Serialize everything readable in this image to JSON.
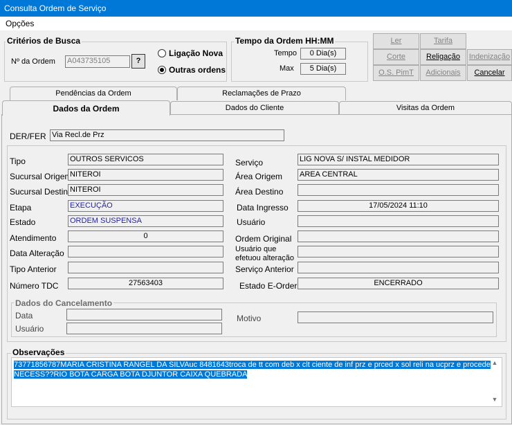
{
  "window": {
    "title": "Consulta Ordem de Serviço"
  },
  "menu": {
    "opcoes": "Opções"
  },
  "criterios": {
    "title": "Critérios de Busca",
    "ordem_label": "Nº da Ordem",
    "ordem_value": "A043735105",
    "lookup_button": "?",
    "radio_ligacao": "Ligação Nova",
    "radio_outras": "Outras ordens",
    "selected": "Outras ordens"
  },
  "tempo": {
    "title": "Tempo da Ordem HH:MM",
    "tempo_label": "Tempo",
    "tempo_value": "0 Dia(s)",
    "max_label": "Max",
    "max_value": "5 Dia(s)"
  },
  "buttons": {
    "ler": "Ler",
    "tarifa": "Tarifa",
    "corte": "Corte",
    "religacao": "Religação",
    "indenizacao": "Indenização",
    "os_pimt": "O.S. PimT",
    "adicionais": "Adicionais",
    "cancelar": "Cancelar"
  },
  "tabs": {
    "row1": [
      "Pendências da Ordem",
      "Reclamações de Prazo"
    ],
    "row2": [
      "Dados da Ordem",
      "Dados do Cliente",
      "Visitas da Ordem"
    ],
    "active": "Dados da Ordem"
  },
  "der_fer": {
    "label": "DER/FER",
    "value": "Via Recl.de Prz"
  },
  "dados": {
    "tipo_label": "Tipo",
    "tipo_value": "OUTROS SERVICOS",
    "servico_label": "Serviço",
    "servico_value": "LIG NOVA S/ INSTAL MEDIDOR",
    "sucursal_origem_label": "Sucursal Origem",
    "sucursal_origem_value": "NITEROI",
    "area_origem_label": "Área Origem",
    "area_origem_value": "AREA CENTRAL",
    "sucursal_destino_label": "Sucursal Destino",
    "sucursal_destino_value": "NITEROI",
    "area_destino_label": "Área Destino",
    "area_destino_value": "",
    "etapa_label": "Etapa",
    "etapa_value": "EXECUÇÃO",
    "data_ingresso_label": "Data Ingresso",
    "data_ingresso_value": "17/05/2024 11:10",
    "estado_label": "Estado",
    "estado_value": "ORDEM SUSPENSA",
    "usuario_label": "Usuário",
    "usuario_value": "",
    "atendimento_label": "Atendimento",
    "atendimento_value": "0",
    "ordem_original_label": "Ordem Original",
    "ordem_original_value": "",
    "data_alteracao_label": "Data Alteração",
    "data_alteracao_value": "",
    "usuario_alteracao_label_1": "Usuário que",
    "usuario_alteracao_label_2": "efetuou alteração",
    "usuario_alteracao_value": "",
    "tipo_anterior_label": "Tipo Anterior",
    "tipo_anterior_value": "",
    "servico_anterior_label": "Serviço Anterior",
    "servico_anterior_value": "",
    "numero_tdc_label": "Número TDC",
    "numero_tdc_value": "27563403",
    "estado_eorder_label": "Estado E-Order",
    "estado_eorder_value": "ENCERRADO"
  },
  "cancelamento": {
    "title": "Dados do Cancelamento",
    "data_label": "Data",
    "data_value": "",
    "usuario_label": "Usuário",
    "usuario_value": "",
    "motivo_label": "Motivo",
    "motivo_value": ""
  },
  "observacoes": {
    "title": "Observações",
    "line1": "73771856787MARIA CRISTINA RANGEL DA SILVAuc 8481643troca de tt com deb x clt ciente de inf prz e prced x sol reli na ucprz e procede",
    "line2": "NECESS??RIO BOTA CARGA BOTA DJUNTOR CAIXA QUEBRADA"
  }
}
